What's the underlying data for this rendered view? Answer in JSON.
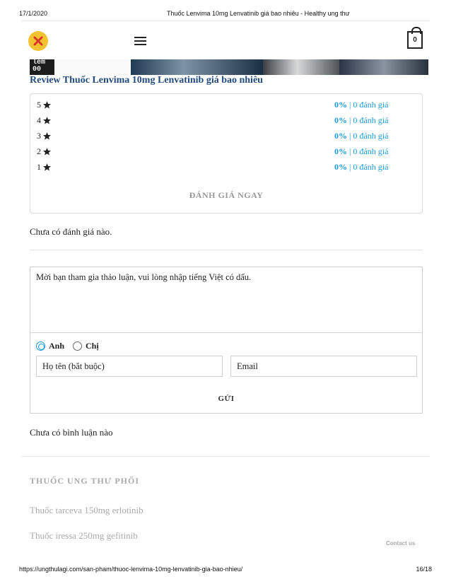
{
  "print": {
    "date": "17/1/2020",
    "title": "Thuốc Lenvima 10mg Lenvatinib giá bao nhiêu - Healthy ung thư",
    "url": "https://ungthulagi.com/san-pham/thuoc-lenvima-10mg-lenvatinib-gia-bao-nhieu/",
    "page": "16/18"
  },
  "header": {
    "cart_count": "0",
    "banner_text": "lem 00"
  },
  "review": {
    "title": "Review Thuốc Lenvima 10mg Lenvatinib giá bao nhiêu",
    "rows": [
      {
        "stars": "5",
        "percent": "0%",
        "sep": " | ",
        "count": "0 đánh giá"
      },
      {
        "stars": "4",
        "percent": "0%",
        "sep": " | ",
        "count": "0 đánh giá"
      },
      {
        "stars": "3",
        "percent": "0%",
        "sep": " | ",
        "count": "0 đánh giá"
      },
      {
        "stars": "2",
        "percent": "0%",
        "sep": " | ",
        "count": "0 đánh giá"
      },
      {
        "stars": "1",
        "percent": "0%",
        "sep": " | ",
        "count": "0 đánh giá"
      }
    ],
    "rate_now": "ĐÁNH GIÁ NGAY",
    "empty_text": "Chưa có đánh giá nào."
  },
  "comment": {
    "placeholder": "Mời bạn tham gia thảo luận, vui lòng nhập tiếng Việt có dấu.",
    "gender_options": [
      "Anh",
      "Chị"
    ],
    "selected_gender": "Anh",
    "name_placeholder": "Họ tên (bắt buộc)",
    "email_placeholder": "Email",
    "submit_label": "GỬI",
    "empty_text": "Chưa có bình luận nào"
  },
  "related": {
    "section_title": "THUỐC UNG THƯ PHỔI",
    "links": [
      "Thuốc tarceva 150mg erlotinib",
      "Thuốc iressa 250mg gefitinib"
    ]
  },
  "contact_label": "Contact us",
  "colors": {
    "accent": "#1a9ad8",
    "title": "#234a7c",
    "muted": "#aaaaaa",
    "logo": "#f2c230"
  }
}
